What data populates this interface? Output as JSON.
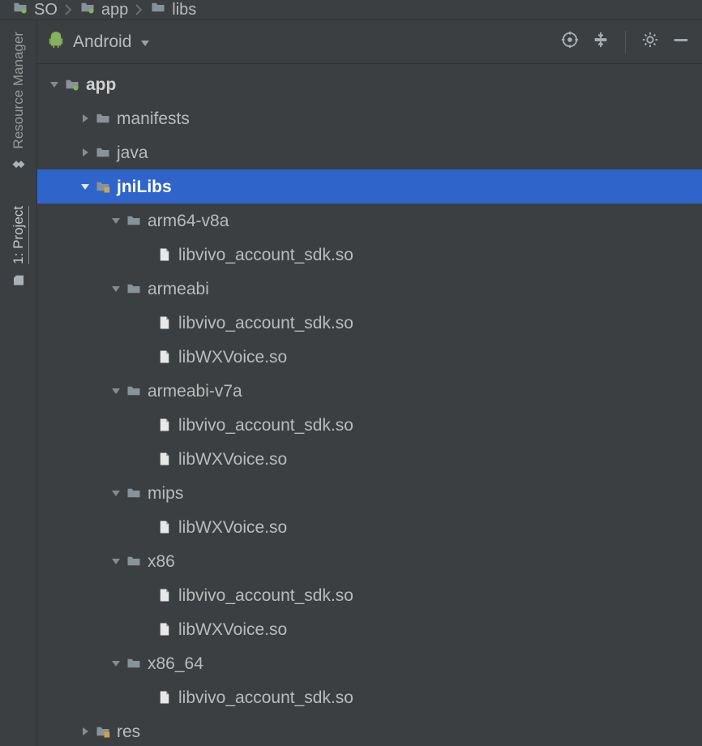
{
  "breadcrumb": [
    {
      "label": "SO",
      "icon": "module"
    },
    {
      "label": "app",
      "icon": "module"
    },
    {
      "label": "libs",
      "icon": "folder"
    }
  ],
  "toolstrip": {
    "resource_manager": "Resource Manager",
    "project": "1: Project"
  },
  "panel": {
    "view_selector": "Android"
  },
  "tree": [
    {
      "depth": 0,
      "arrow": "down",
      "icon": "module",
      "label": "app",
      "bold": true
    },
    {
      "depth": 1,
      "arrow": "right",
      "icon": "folder",
      "label": "manifests"
    },
    {
      "depth": 1,
      "arrow": "right",
      "icon": "folder",
      "label": "java"
    },
    {
      "depth": 1,
      "arrow": "down",
      "icon": "folder-res",
      "label": "jniLibs",
      "selected": true
    },
    {
      "depth": 2,
      "arrow": "down",
      "icon": "folder",
      "label": "arm64-v8a"
    },
    {
      "depth": 3,
      "arrow": "",
      "icon": "file",
      "label": "libvivo_account_sdk.so"
    },
    {
      "depth": 2,
      "arrow": "down",
      "icon": "folder",
      "label": "armeabi"
    },
    {
      "depth": 3,
      "arrow": "",
      "icon": "file",
      "label": "libvivo_account_sdk.so"
    },
    {
      "depth": 3,
      "arrow": "",
      "icon": "file",
      "label": "libWXVoice.so"
    },
    {
      "depth": 2,
      "arrow": "down",
      "icon": "folder",
      "label": "armeabi-v7a"
    },
    {
      "depth": 3,
      "arrow": "",
      "icon": "file",
      "label": "libvivo_account_sdk.so"
    },
    {
      "depth": 3,
      "arrow": "",
      "icon": "file",
      "label": "libWXVoice.so"
    },
    {
      "depth": 2,
      "arrow": "down",
      "icon": "folder",
      "label": "mips"
    },
    {
      "depth": 3,
      "arrow": "",
      "icon": "file",
      "label": "libWXVoice.so"
    },
    {
      "depth": 2,
      "arrow": "down",
      "icon": "folder",
      "label": "x86"
    },
    {
      "depth": 3,
      "arrow": "",
      "icon": "file",
      "label": "libvivo_account_sdk.so"
    },
    {
      "depth": 3,
      "arrow": "",
      "icon": "file",
      "label": "libWXVoice.so"
    },
    {
      "depth": 2,
      "arrow": "down",
      "icon": "folder",
      "label": "x86_64"
    },
    {
      "depth": 3,
      "arrow": "",
      "icon": "file",
      "label": "libvivo_account_sdk.so"
    },
    {
      "depth": 1,
      "arrow": "right",
      "icon": "folder-res",
      "label": "res"
    }
  ]
}
